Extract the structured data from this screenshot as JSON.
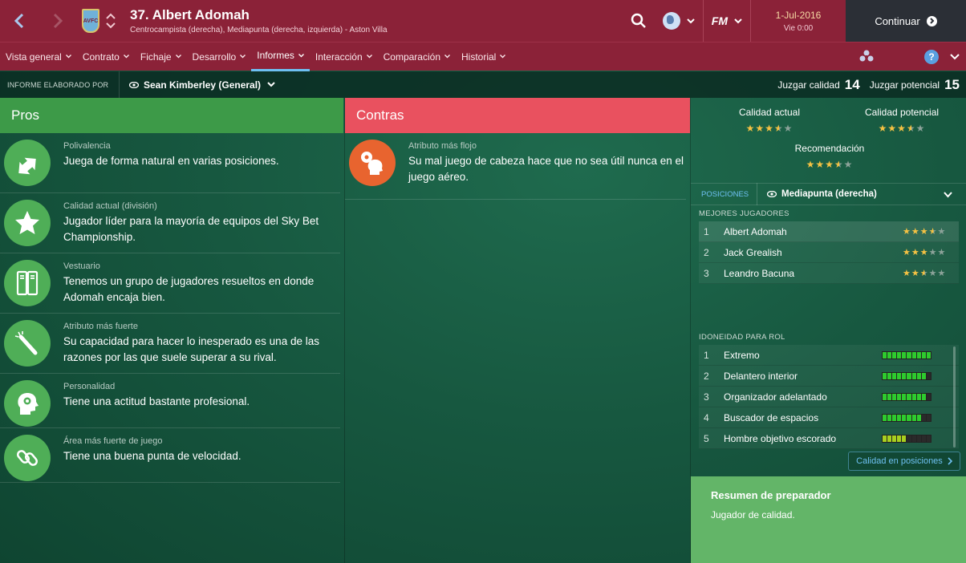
{
  "header": {
    "player_name": "37. Albert Adomah",
    "player_sub": "Centrocampista (derecha), Mediapunta (derecha, izquierda) - Aston Villa",
    "club_badge_text": "AVFC",
    "fm_logo": "FM",
    "date": "1-Jul-2016",
    "day_time": "Vie 0:00",
    "continue_label": "Continuar",
    "accent_color": "#8b2238"
  },
  "tabs": [
    {
      "label": "Vista general",
      "active": false
    },
    {
      "label": "Contrato",
      "active": false
    },
    {
      "label": "Fichaje",
      "active": false
    },
    {
      "label": "Desarrollo",
      "active": false
    },
    {
      "label": "Informes",
      "active": true
    },
    {
      "label": "Interacción",
      "active": false
    },
    {
      "label": "Comparación",
      "active": false
    },
    {
      "label": "Historial",
      "active": false
    }
  ],
  "help_label": "?",
  "report": {
    "made_by_label": "INFORME ELABORADO POR",
    "scout": "Sean Kimberley (General)",
    "judge_quality_label": "Juzgar calidad",
    "judge_quality_value": "14",
    "judge_potential_label": "Juzgar potencial",
    "judge_potential_value": "15"
  },
  "pros": {
    "title": "Pros",
    "color": "#3d9a48",
    "items": [
      {
        "icon": "arrows-icon",
        "label": "Polivalencia",
        "text": "Juega de forma natural en varias posiciones."
      },
      {
        "icon": "star-icon",
        "label": "Calidad actual (división)",
        "text": "Jugador líder para la mayoría de equipos del Sky Bet Championship."
      },
      {
        "icon": "locker-icon",
        "label": "Vestuario",
        "text": "Tenemos un grupo de jugadores resueltos en donde Adomah encaja bien."
      },
      {
        "icon": "firework-icon",
        "label": "Atributo más fuerte",
        "text": "Su capacidad para hacer lo inesperado es una de las razones por las que suele superar a su rival."
      },
      {
        "icon": "head-icon",
        "label": "Personalidad",
        "text": "Tiene una actitud bastante profesional."
      },
      {
        "icon": "link-icon",
        "label": "Área más fuerte de juego",
        "text": "Tiene una buena punta de velocidad."
      }
    ]
  },
  "contras": {
    "title": "Contras",
    "color": "#e9515f",
    "items": [
      {
        "icon": "header-ball-icon",
        "label": "Atributo más flojo",
        "text": "Su mal juego de cabeza hace que no sea útil nunca en el juego aéreo."
      }
    ]
  },
  "ratings": {
    "current_label": "Calidad actual",
    "current_stars": 3.5,
    "potential_label": "Calidad potencial",
    "potential_stars": 3.5,
    "recommendation_label": "Recomendación",
    "recommendation_stars": 3.5
  },
  "positions": {
    "label": "POSICIONES",
    "selected": "Mediapunta (derecha)",
    "best_players_label": "MEJORES JUGADORES",
    "best_players": [
      {
        "rank": "1",
        "name": "Albert Adomah",
        "stars": 3.5
      },
      {
        "rank": "2",
        "name": "Jack Grealish",
        "stars": 3
      },
      {
        "rank": "3",
        "name": "Leandro Bacuna",
        "stars": 2.5
      }
    ],
    "role_label": "IDONEIDAD PARA ROL",
    "roles": [
      {
        "rank": "1",
        "name": "Extremo",
        "suitability": 1.0
      },
      {
        "rank": "2",
        "name": "Delantero interior",
        "suitability": 0.85
      },
      {
        "rank": "3",
        "name": "Organizador adelantado",
        "suitability": 0.85
      },
      {
        "rank": "4",
        "name": "Buscador de espacios",
        "suitability": 0.75
      },
      {
        "rank": "5",
        "name": "Hombre objetivo escorado",
        "suitability": 0.5
      }
    ],
    "quality_button": "Calidad en posiciones"
  },
  "summary": {
    "title": "Resumen de preparador",
    "text": "Jugador de calidad."
  }
}
